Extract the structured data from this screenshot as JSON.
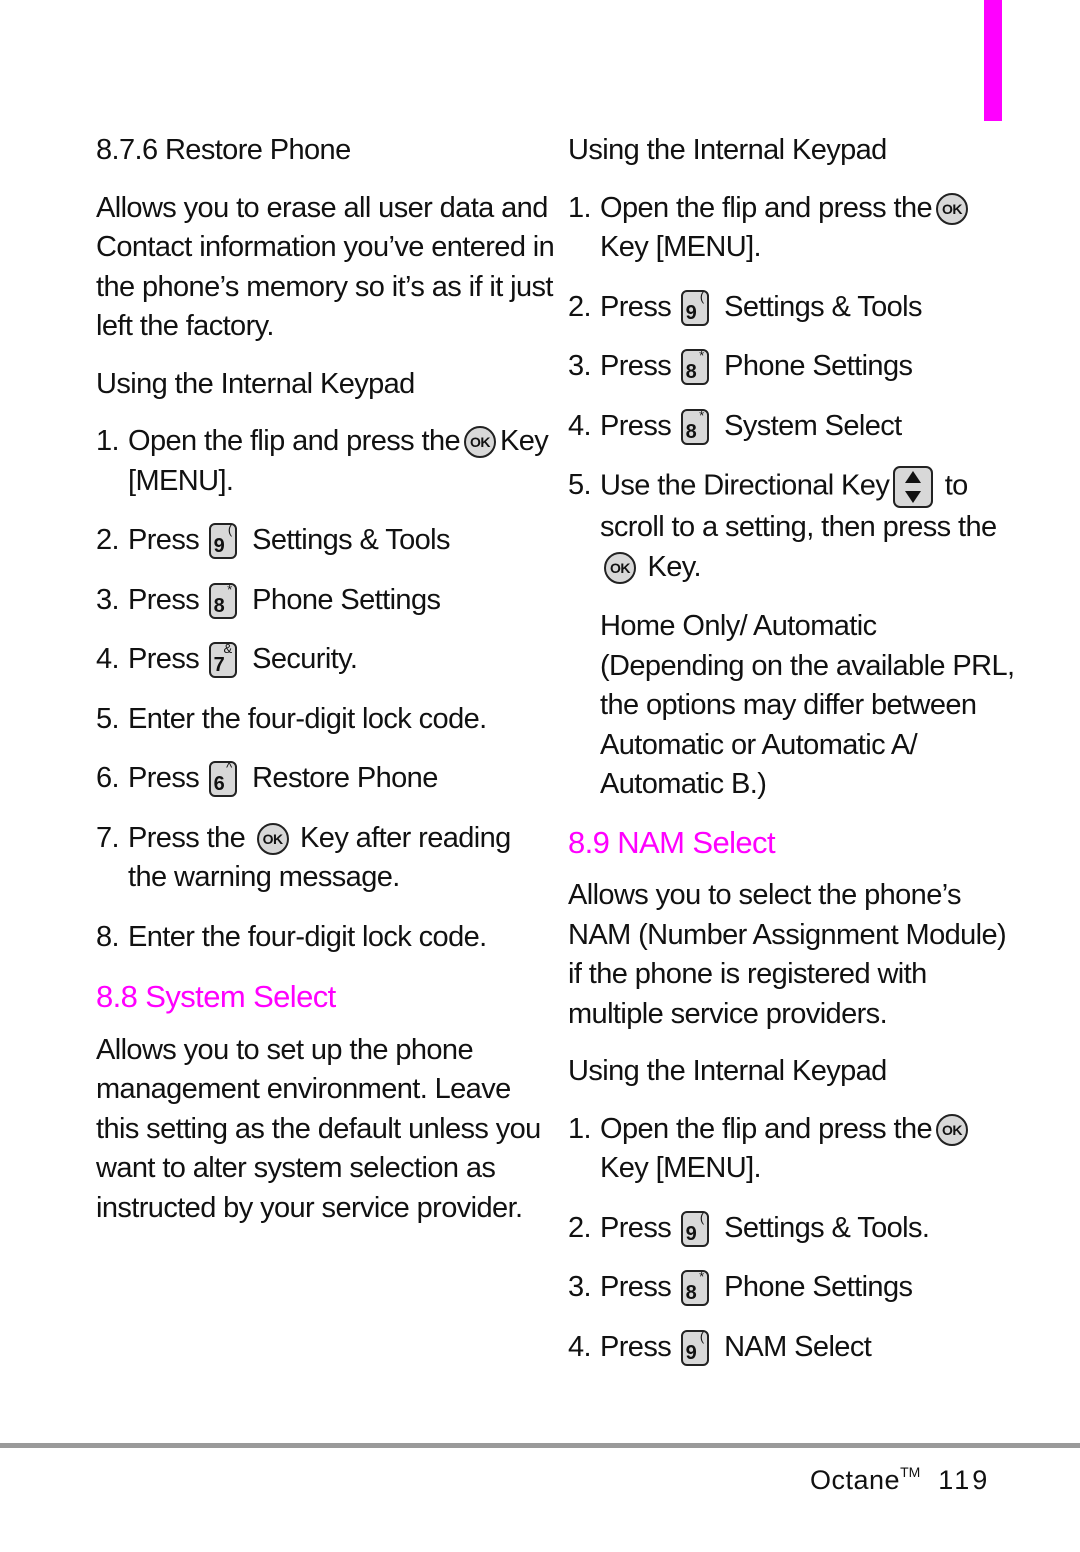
{
  "accent_color": "#ff00ff",
  "left": {
    "section_876_title": "8.7.6 Restore Phone",
    "section_876_desc": "Allows you to erase all user data and Contact information you’ve entered in the phone’s memory so it’s as if it just left the factory.",
    "keypad_label": "Using the Internal Keypad",
    "steps": [
      {
        "num": "1.",
        "pre": "Open the flip and press the",
        "post": "Key [MENU]."
      },
      {
        "num": "2.",
        "pre": "Press",
        "key": "9",
        "sym": "(",
        "post": "Settings & Tools"
      },
      {
        "num": "3.",
        "pre": "Press",
        "key": "8",
        "sym": "*",
        "post": "Phone Settings"
      },
      {
        "num": "4.",
        "pre": "Press",
        "key": "7",
        "sym": "&",
        "post": "Security."
      },
      {
        "num": "5.",
        "text": "Enter the four-digit lock code."
      },
      {
        "num": "6.",
        "pre": "Press",
        "key": "6",
        "sym": "^",
        "post": "Restore Phone"
      },
      {
        "num": "7.",
        "pre": "Press the",
        "post": "Key after reading the warning message."
      },
      {
        "num": "8.",
        "text": "Enter the four-digit lock code."
      }
    ],
    "section_88_title": "8.8  System Select",
    "section_88_desc": "Allows you to set up the phone management environment. Leave this setting as the default unless you want to alter system selection as instructed by your service provider."
  },
  "right": {
    "keypad_label": "Using the Internal Keypad",
    "steps": [
      {
        "num": "1.",
        "pre": "Open the flip and press the",
        "post": "Key [MENU]."
      },
      {
        "num": "2.",
        "pre": "Press",
        "key": "9",
        "sym": "(",
        "post": "Settings & Tools"
      },
      {
        "num": "3.",
        "pre": "Press",
        "key": "8",
        "sym": "*",
        "post": "Phone Settings"
      },
      {
        "num": "4.",
        "pre": "Press",
        "key": "8",
        "sym": "*",
        "post": "System Select"
      },
      {
        "num": "5.",
        "pre": "Use the Directional Key",
        "mid": "to scroll to a setting, then press the",
        "post": "Key."
      }
    ],
    "options_note": "Home Only/ Automatic (Depending on the available PRL, the options may differ between Automatic or Automatic A/ Automatic B.)",
    "section_89_title": "8.9  NAM Select",
    "section_89_desc": "Allows you to select the phone’s NAM (Number Assignment Module) if the phone is registered with multiple service providers.",
    "keypad_label_2": "Using the Internal Keypad",
    "steps_2": [
      {
        "num": "1.",
        "pre": "Open the flip and press the",
        "post": "Key [MENU]."
      },
      {
        "num": "2.",
        "pre": "Press",
        "key": "9",
        "sym": "(",
        "post": "Settings & Tools."
      },
      {
        "num": "3.",
        "pre": "Press",
        "key": "8",
        "sym": "*",
        "post": "Phone Settings"
      },
      {
        "num": "4.",
        "pre": "Press",
        "key": "9",
        "sym": "(",
        "post": "NAM Select"
      }
    ]
  },
  "icons": {
    "ok_label": "OK"
  },
  "footer": {
    "product": "Octane",
    "trademark": "TM",
    "page": "119"
  }
}
